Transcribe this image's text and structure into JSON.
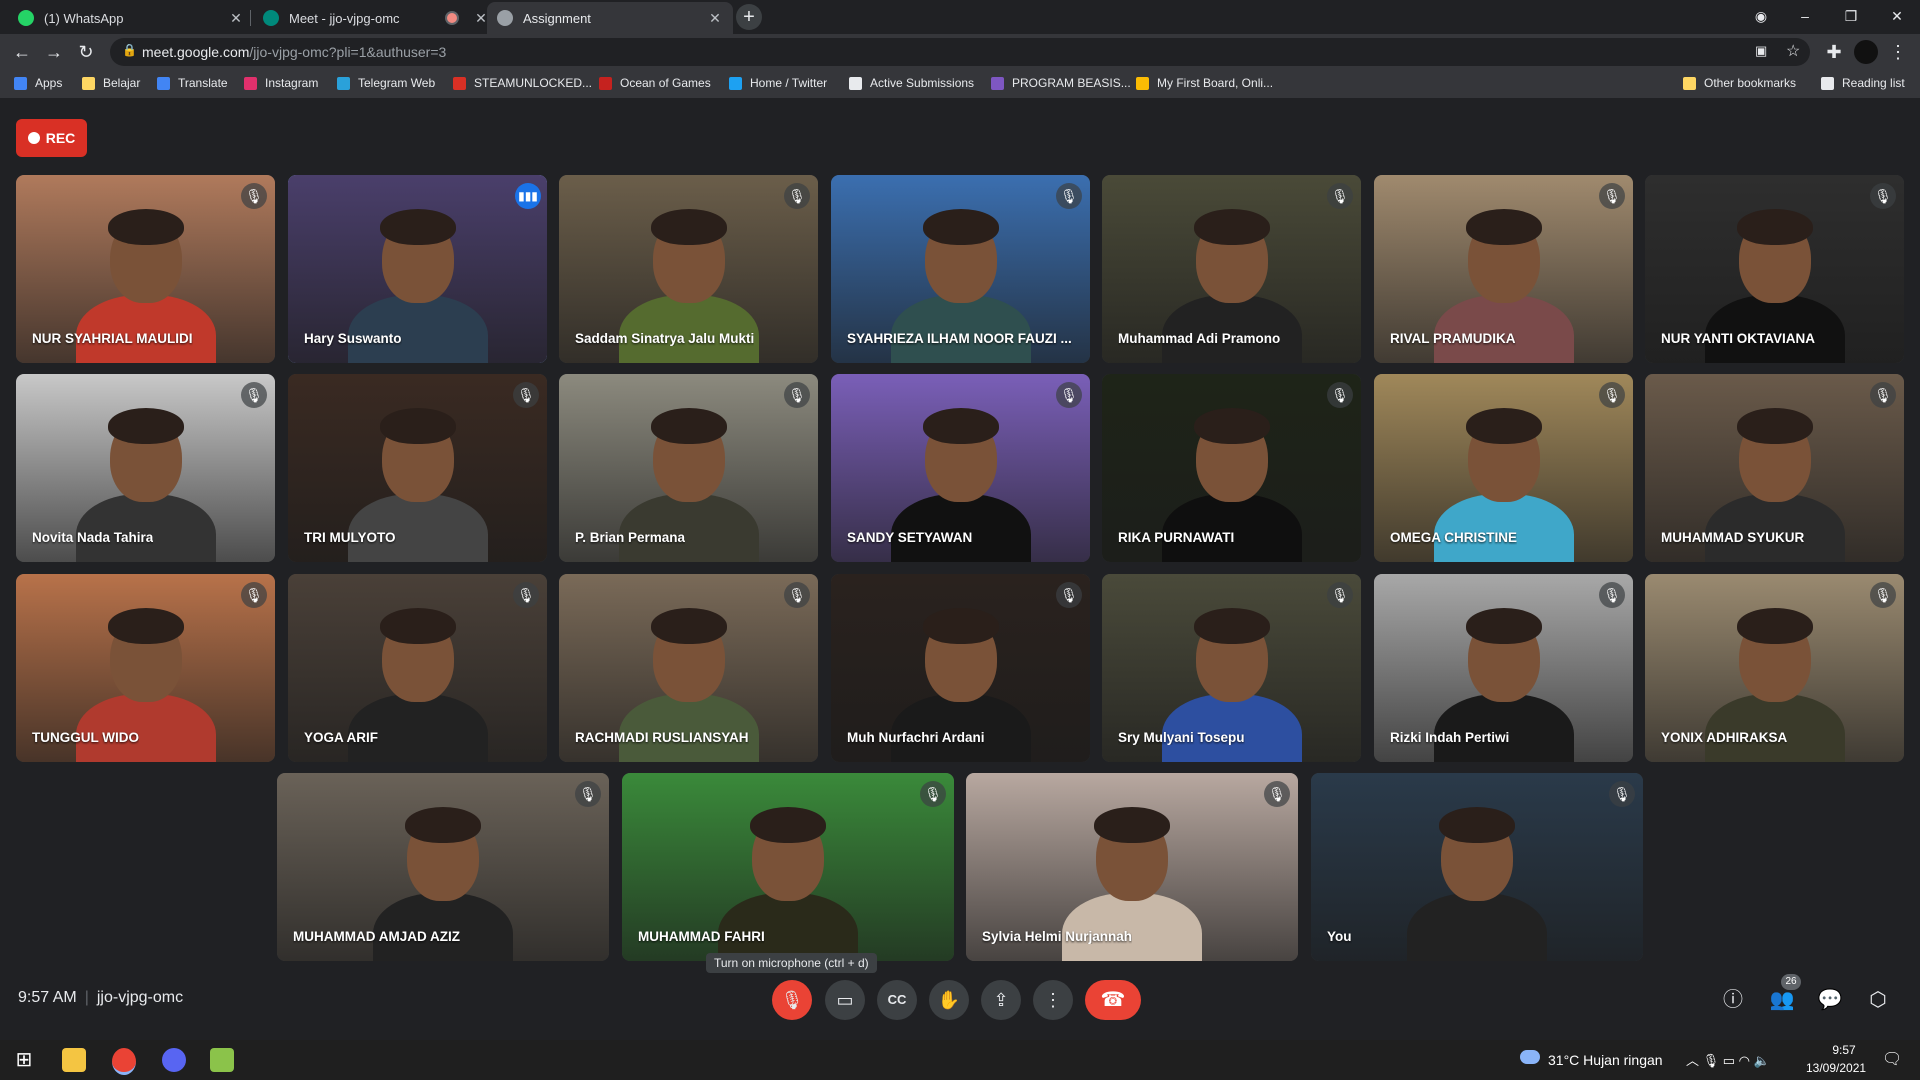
{
  "tabs": [
    {
      "title": "(1) WhatsApp",
      "color": "#25d366"
    },
    {
      "title": "Meet - jjo-vjpg-omc",
      "color": "#00897b"
    },
    {
      "title": "Assignment",
      "color": "#9aa0a6"
    }
  ],
  "url": {
    "host": "meet.google.com",
    "path": "/jjo-vjpg-omc?pli=1&authuser=3"
  },
  "bookmarks": [
    {
      "label": "Apps",
      "color": "#4285f4"
    },
    {
      "label": "Belajar",
      "color": "#fdd663"
    },
    {
      "label": "Translate",
      "color": "#4285f4"
    },
    {
      "label": "Instagram",
      "color": "#e1306c"
    },
    {
      "label": "Telegram Web",
      "color": "#2aa1da"
    },
    {
      "label": "STEAMUNLOCKED...",
      "color": "#d93025"
    },
    {
      "label": "Ocean of Games",
      "color": "#c5221f"
    },
    {
      "label": "Home / Twitter",
      "color": "#1da1f2"
    },
    {
      "label": "Active Submissions",
      "color": "#e8eaed"
    },
    {
      "label": "PROGRAM BEASIS...",
      "color": "#7e57c2"
    },
    {
      "label": "My First Board, Onli...",
      "color": "#fbbc04"
    }
  ],
  "bookmarks_right": [
    {
      "label": "Other bookmarks",
      "color": "#fdd663"
    },
    {
      "label": "Reading list",
      "color": "#e8eaed"
    }
  ],
  "rec_label": "REC",
  "participants": [
    {
      "name": "NUR SYAHRIAL MAULIDI",
      "bg": "#b07a5c",
      "shirt": "#c0392b"
    },
    {
      "name": "Hary Suswanto",
      "bg": "#4a3f6b",
      "shirt": "#2c3e50"
    },
    {
      "name": "Saddam Sinatrya Jalu Mukti",
      "bg": "#6b5e4a",
      "shirt": "#556b2f"
    },
    {
      "name": "SYAHRIEZA ILHAM NOOR FAUZI ...",
      "bg": "#3b6fb0",
      "shirt": "#2f4f4f"
    },
    {
      "name": "Muhammad Adi Pramono",
      "bg": "#4a4a38",
      "shirt": "#222"
    },
    {
      "name": "RIVAL PRAMUDIKA",
      "bg": "#a08a6e",
      "shirt": "#7a4a4a"
    },
    {
      "name": "NUR YANTI OKTAVIANA",
      "bg": "#2e2e2e",
      "shirt": "#111"
    },
    {
      "name": "Novita Nada Tahira",
      "bg": "#c8c8c8",
      "shirt": "#333"
    },
    {
      "name": "TRI MULYOTO",
      "bg": "#3a2a22",
      "shirt": "#444"
    },
    {
      "name": "P. Brian Permana",
      "bg": "#8c8a7e",
      "shirt": "#3a3a30"
    },
    {
      "name": "SANDY SETYAWAN",
      "bg": "#7a5fb8",
      "shirt": "#111"
    },
    {
      "name": "RIKA PURNAWATI",
      "bg": "#1e2418",
      "shirt": "#0f0f0f"
    },
    {
      "name": "OMEGA CHRISTINE",
      "bg": "#a0885a",
      "shirt": "#3fa7c9"
    },
    {
      "name": "MUHAMMAD SYUKUR",
      "bg": "#6a5a4a",
      "shirt": "#2b2b2b"
    },
    {
      "name": "TUNGGUL WIDO",
      "bg": "#b8724a",
      "shirt": "#b03a2e"
    },
    {
      "name": "YOGA ARIF",
      "bg": "#4a4038",
      "shirt": "#222"
    },
    {
      "name": "RACHMADI RUSLIANSYAH",
      "bg": "#7a6a58",
      "shirt": "#4a5a3a"
    },
    {
      "name": "Muh Nurfachri Ardani",
      "bg": "#2a221e",
      "shirt": "#1a1a1a"
    },
    {
      "name": "Sry Mulyani Tosepu",
      "bg": "#4a4a3a",
      "shirt": "#2d4fa0"
    },
    {
      "name": "Rizki Indah Pertiwi",
      "bg": "#a8a8a8",
      "shirt": "#1a1a1a"
    },
    {
      "name": "YONIX ADHIRAKSA",
      "bg": "#9a8a70",
      "shirt": "#3a3a2a"
    },
    {
      "name": "MUHAMMAD AMJAD AZIZ",
      "bg": "#6a6258",
      "shirt": "#222"
    },
    {
      "name": "MUHAMMAD FAHRI",
      "bg": "#3a8a3a",
      "shirt": "#2a2a1a"
    },
    {
      "name": "Sylvia Helmi Nurjannah",
      "bg": "#b8a8a0",
      "shirt": "#c8b8a8"
    },
    {
      "name": "You",
      "bg": "#2a3a4a",
      "shirt": "#222"
    }
  ],
  "speaking": "Hary Suswanto",
  "tooltip": "Turn on microphone (ctrl + d)",
  "time": "9:57 AM",
  "meeting_code": "jjo-vjpg-omc",
  "participant_count": "26",
  "taskbar": {
    "weather": "31°C  Hujan ringan",
    "time": "9:57",
    "date": "13/09/2021"
  }
}
